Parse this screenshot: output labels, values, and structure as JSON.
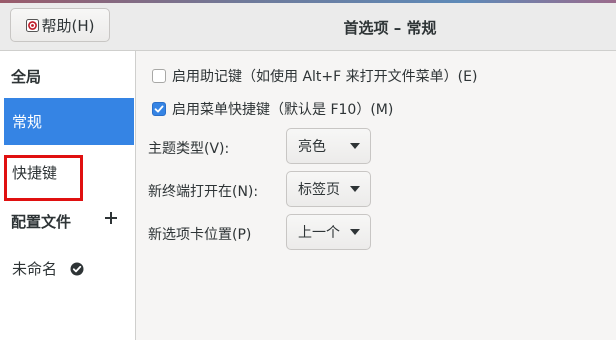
{
  "headerbar": {
    "help_label": "帮助(H)",
    "title": "首选项 – 常规"
  },
  "sidebar": {
    "global_header": "全局",
    "items": [
      {
        "label": "常规",
        "selected": true
      },
      {
        "label": "快捷键",
        "selected": false
      }
    ],
    "profiles_header": "配置文件",
    "profiles": [
      {
        "label": "未命名",
        "default": true
      }
    ]
  },
  "general": {
    "mnemonics": {
      "label": "启用助记键（如使用 Alt+F 来打开文件菜单）(E)",
      "checked": false
    },
    "menu_accel": {
      "label": "启用菜单快捷键（默认是 F10）(M)",
      "checked": true
    },
    "theme": {
      "label": "主题类型(V):",
      "value": "亮色"
    },
    "new_terminal": {
      "label": "新终端打开在(N):",
      "value": "标签页"
    },
    "tab_position": {
      "label": "新选项卡位置(P)",
      "value": "上一个"
    }
  },
  "colors": {
    "accent": "#3584e4",
    "highlight_box": "#e01010"
  }
}
